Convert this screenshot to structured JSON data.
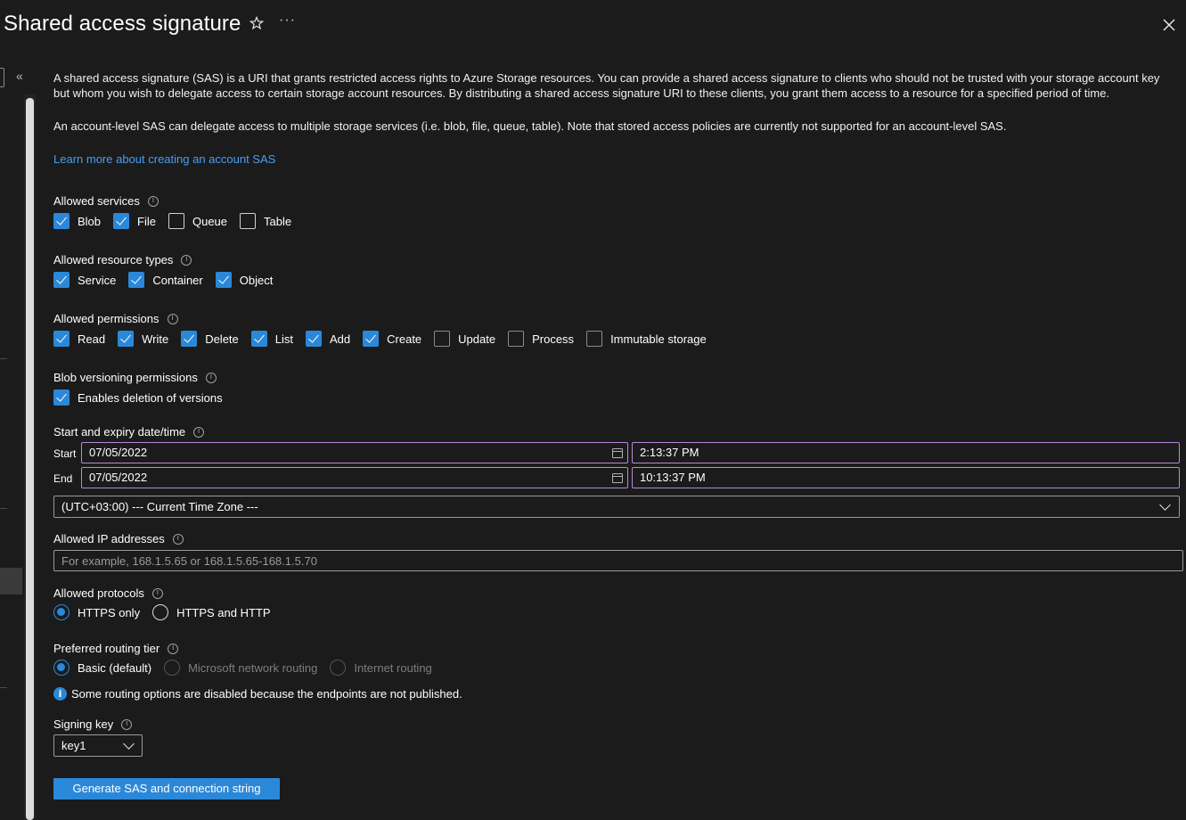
{
  "header": {
    "title": "Shared access signature",
    "favorite_icon": "star-icon",
    "more_label": "···",
    "close_icon": "close-icon"
  },
  "rail": {
    "collapse_label": "«"
  },
  "intro": {
    "paragraph1": "A shared access signature (SAS) is a URI that grants restricted access rights to Azure Storage resources. You can provide a shared access signature to clients who should not be trusted with your storage account key but whom you wish to delegate access to certain storage account resources. By distributing a shared access signature URI to these clients, you grant them access to a resource for a specified period of time.",
    "paragraph2": "An account-level SAS can delegate access to multiple storage services (i.e. blob, file, queue, table). Note that stored access policies are currently not supported for an account-level SAS.",
    "learn_more_link": "Learn more about creating an account SAS"
  },
  "allowed_services": {
    "label": "Allowed services",
    "options": [
      {
        "label": "Blob",
        "checked": true
      },
      {
        "label": "File",
        "checked": true
      },
      {
        "label": "Queue",
        "checked": false
      },
      {
        "label": "Table",
        "checked": false
      }
    ]
  },
  "allowed_resource_types": {
    "label": "Allowed resource types",
    "options": [
      {
        "label": "Service",
        "checked": true
      },
      {
        "label": "Container",
        "checked": true
      },
      {
        "label": "Object",
        "checked": true
      }
    ]
  },
  "allowed_permissions": {
    "label": "Allowed permissions",
    "options": [
      {
        "label": "Read",
        "checked": true
      },
      {
        "label": "Write",
        "checked": true
      },
      {
        "label": "Delete",
        "checked": true
      },
      {
        "label": "List",
        "checked": true
      },
      {
        "label": "Add",
        "checked": true
      },
      {
        "label": "Create",
        "checked": true
      },
      {
        "label": "Update",
        "checked": false
      },
      {
        "label": "Process",
        "checked": false
      },
      {
        "label": "Immutable storage",
        "checked": false
      }
    ]
  },
  "blob_versioning": {
    "label": "Blob versioning permissions",
    "option": {
      "label": "Enables deletion of versions",
      "checked": true
    }
  },
  "datetime": {
    "label": "Start and expiry date/time",
    "start_label": "Start",
    "start_date": "07/05/2022",
    "start_time": "2:13:37 PM",
    "end_label": "End",
    "end_date": "07/05/2022",
    "end_time": "10:13:37 PM",
    "timezone": "(UTC+03:00) --- Current Time Zone ---"
  },
  "allowed_ip": {
    "label": "Allowed IP addresses",
    "placeholder": "For example, 168.1.5.65 or 168.1.5.65-168.1.5.70",
    "value": ""
  },
  "allowed_protocols": {
    "label": "Allowed protocols",
    "options": [
      {
        "label": "HTTPS only",
        "selected": true
      },
      {
        "label": "HTTPS and HTTP",
        "selected": false
      }
    ]
  },
  "routing_tier": {
    "label": "Preferred routing tier",
    "options": [
      {
        "label": "Basic (default)",
        "selected": true,
        "disabled": false
      },
      {
        "label": "Microsoft network routing",
        "selected": false,
        "disabled": true
      },
      {
        "label": "Internet routing",
        "selected": false,
        "disabled": true
      }
    ],
    "notice": "Some routing options are disabled because the endpoints are not published."
  },
  "signing_key": {
    "label": "Signing key",
    "value": "key1"
  },
  "actions": {
    "generate_label": "Generate SAS and connection string"
  },
  "colors": {
    "accent": "#2b88d8",
    "link": "#479ef5",
    "focus_border": "#b38ad8",
    "background": "#1b1b1b"
  }
}
